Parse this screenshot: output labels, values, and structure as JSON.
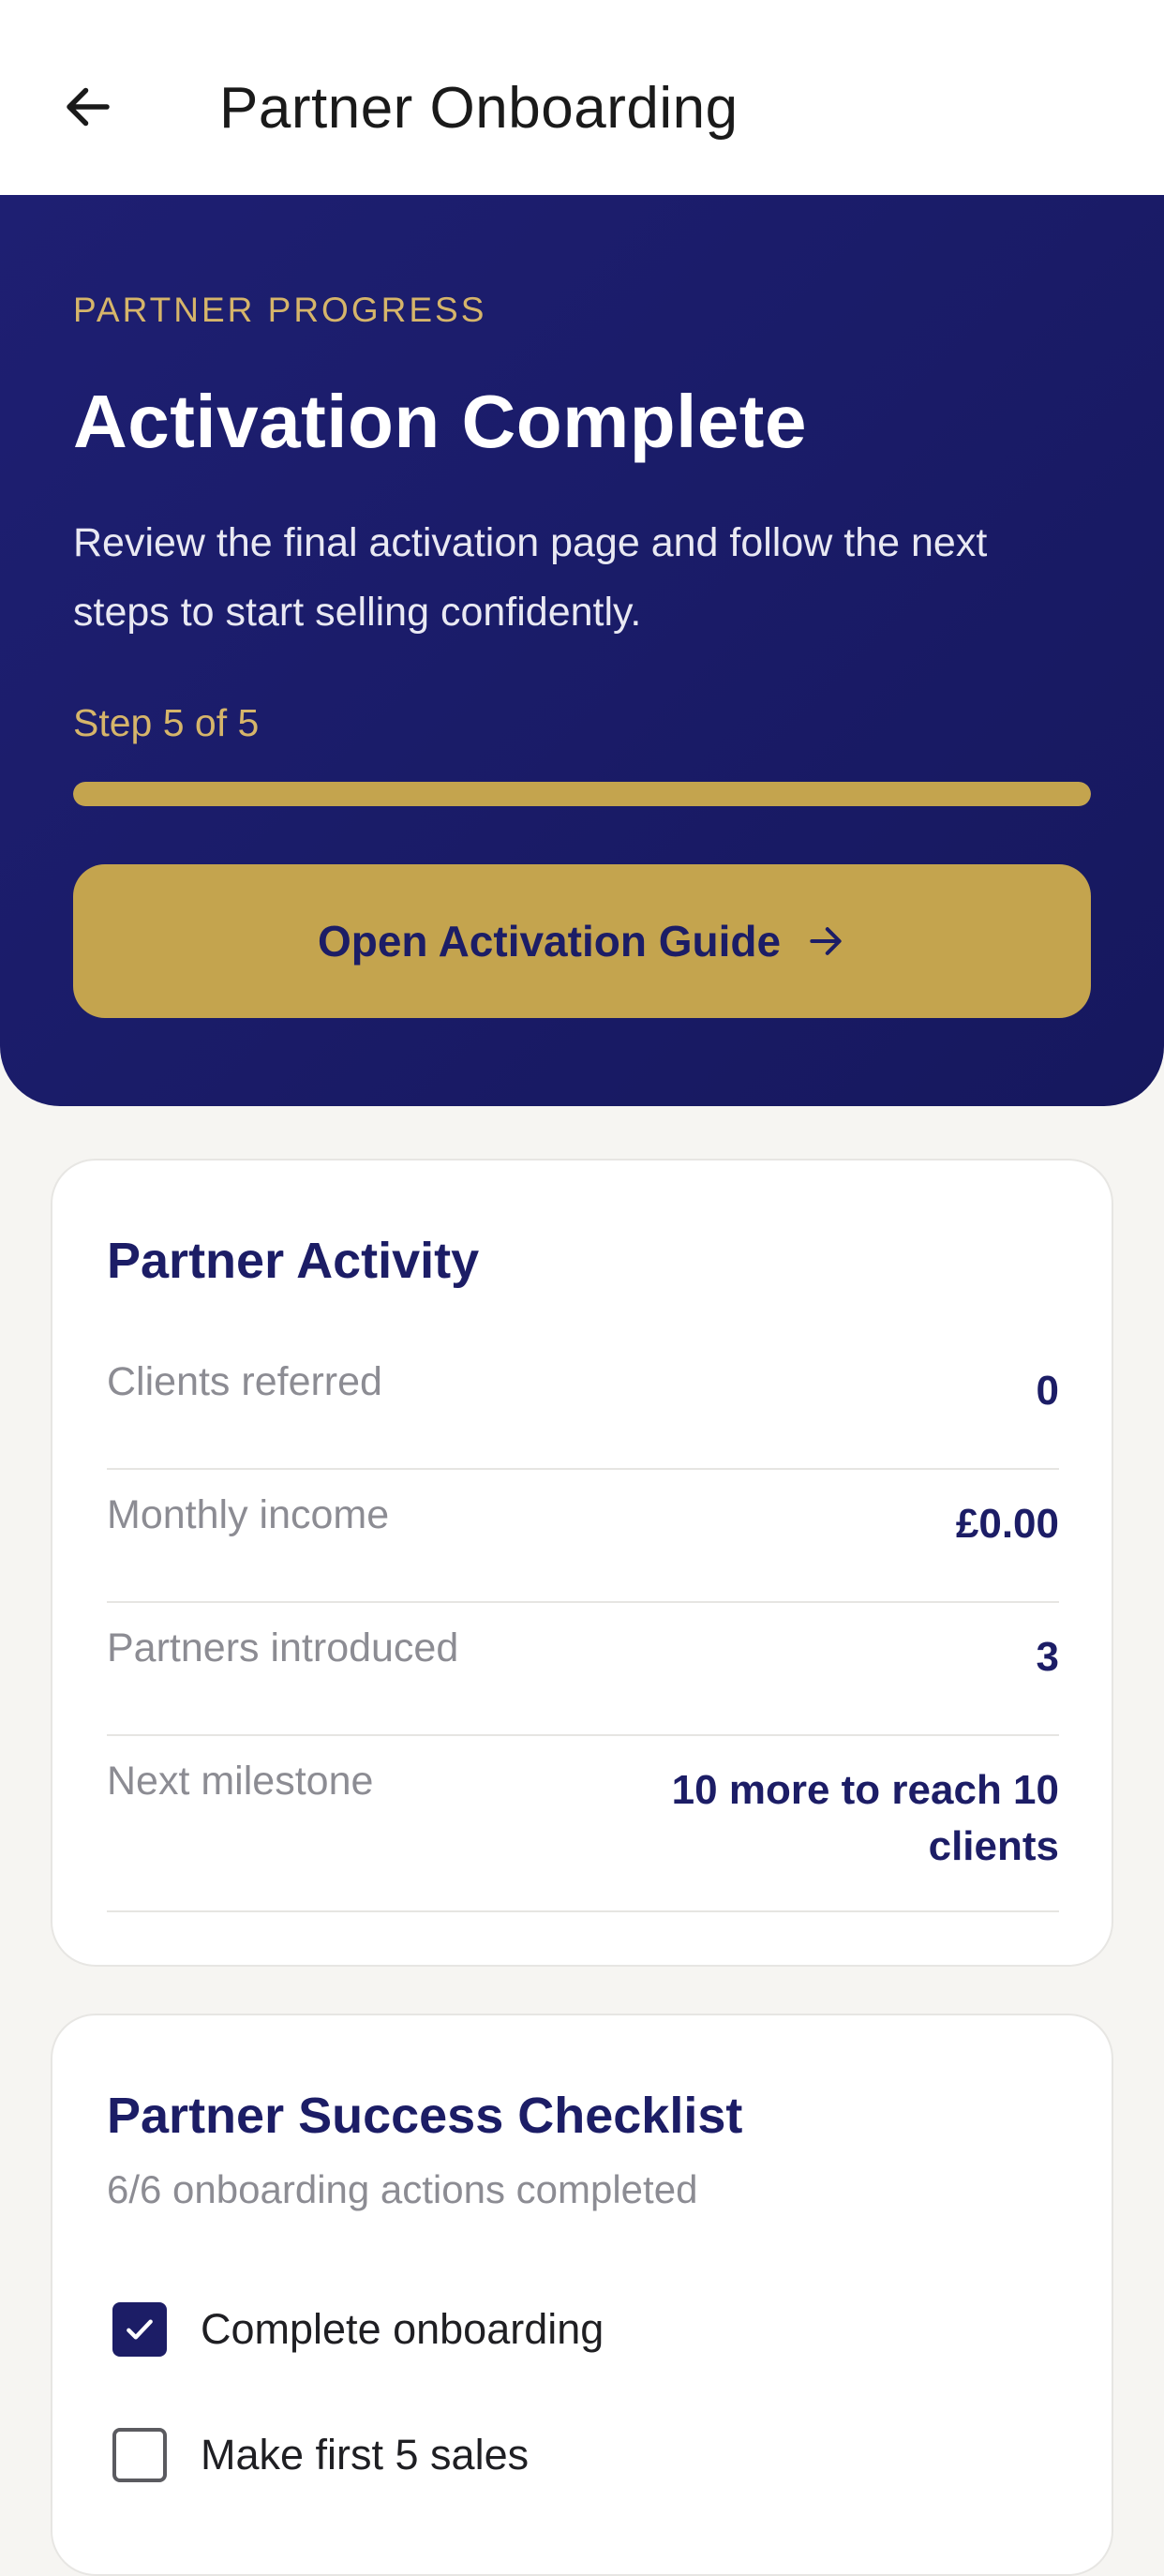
{
  "appbar": {
    "back_icon": "arrow-left-icon",
    "title": "Partner Onboarding"
  },
  "hero": {
    "eyebrow": "PARTNER PROGRESS",
    "title": "Activation Complete",
    "description": "Review the final activation page and follow the next steps to start selling confidently.",
    "step_label": "Step 5 of 5",
    "progress_fraction": 1.0,
    "cta_label": "Open Activation Guide",
    "cta_icon": "arrow-right-icon"
  },
  "activity": {
    "title": "Partner Activity",
    "rows": [
      {
        "label": "Clients referred",
        "value": "0"
      },
      {
        "label": "Monthly income",
        "value": "£0.00"
      },
      {
        "label": "Partners introduced",
        "value": "3"
      },
      {
        "label": "Next milestone",
        "value": "10 more to reach 10 clients"
      }
    ]
  },
  "checklist": {
    "title": "Partner Success Checklist",
    "summary": "6/6 onboarding actions completed",
    "items": [
      {
        "label": "Complete onboarding",
        "checked": true
      },
      {
        "label": "Make first 5 sales",
        "checked": false
      }
    ]
  },
  "colors": {
    "navy": "#1c1d66",
    "gold": "#c4a44e",
    "eyebrow_gold": "#d6b56a",
    "background": "#f6f5f2"
  }
}
